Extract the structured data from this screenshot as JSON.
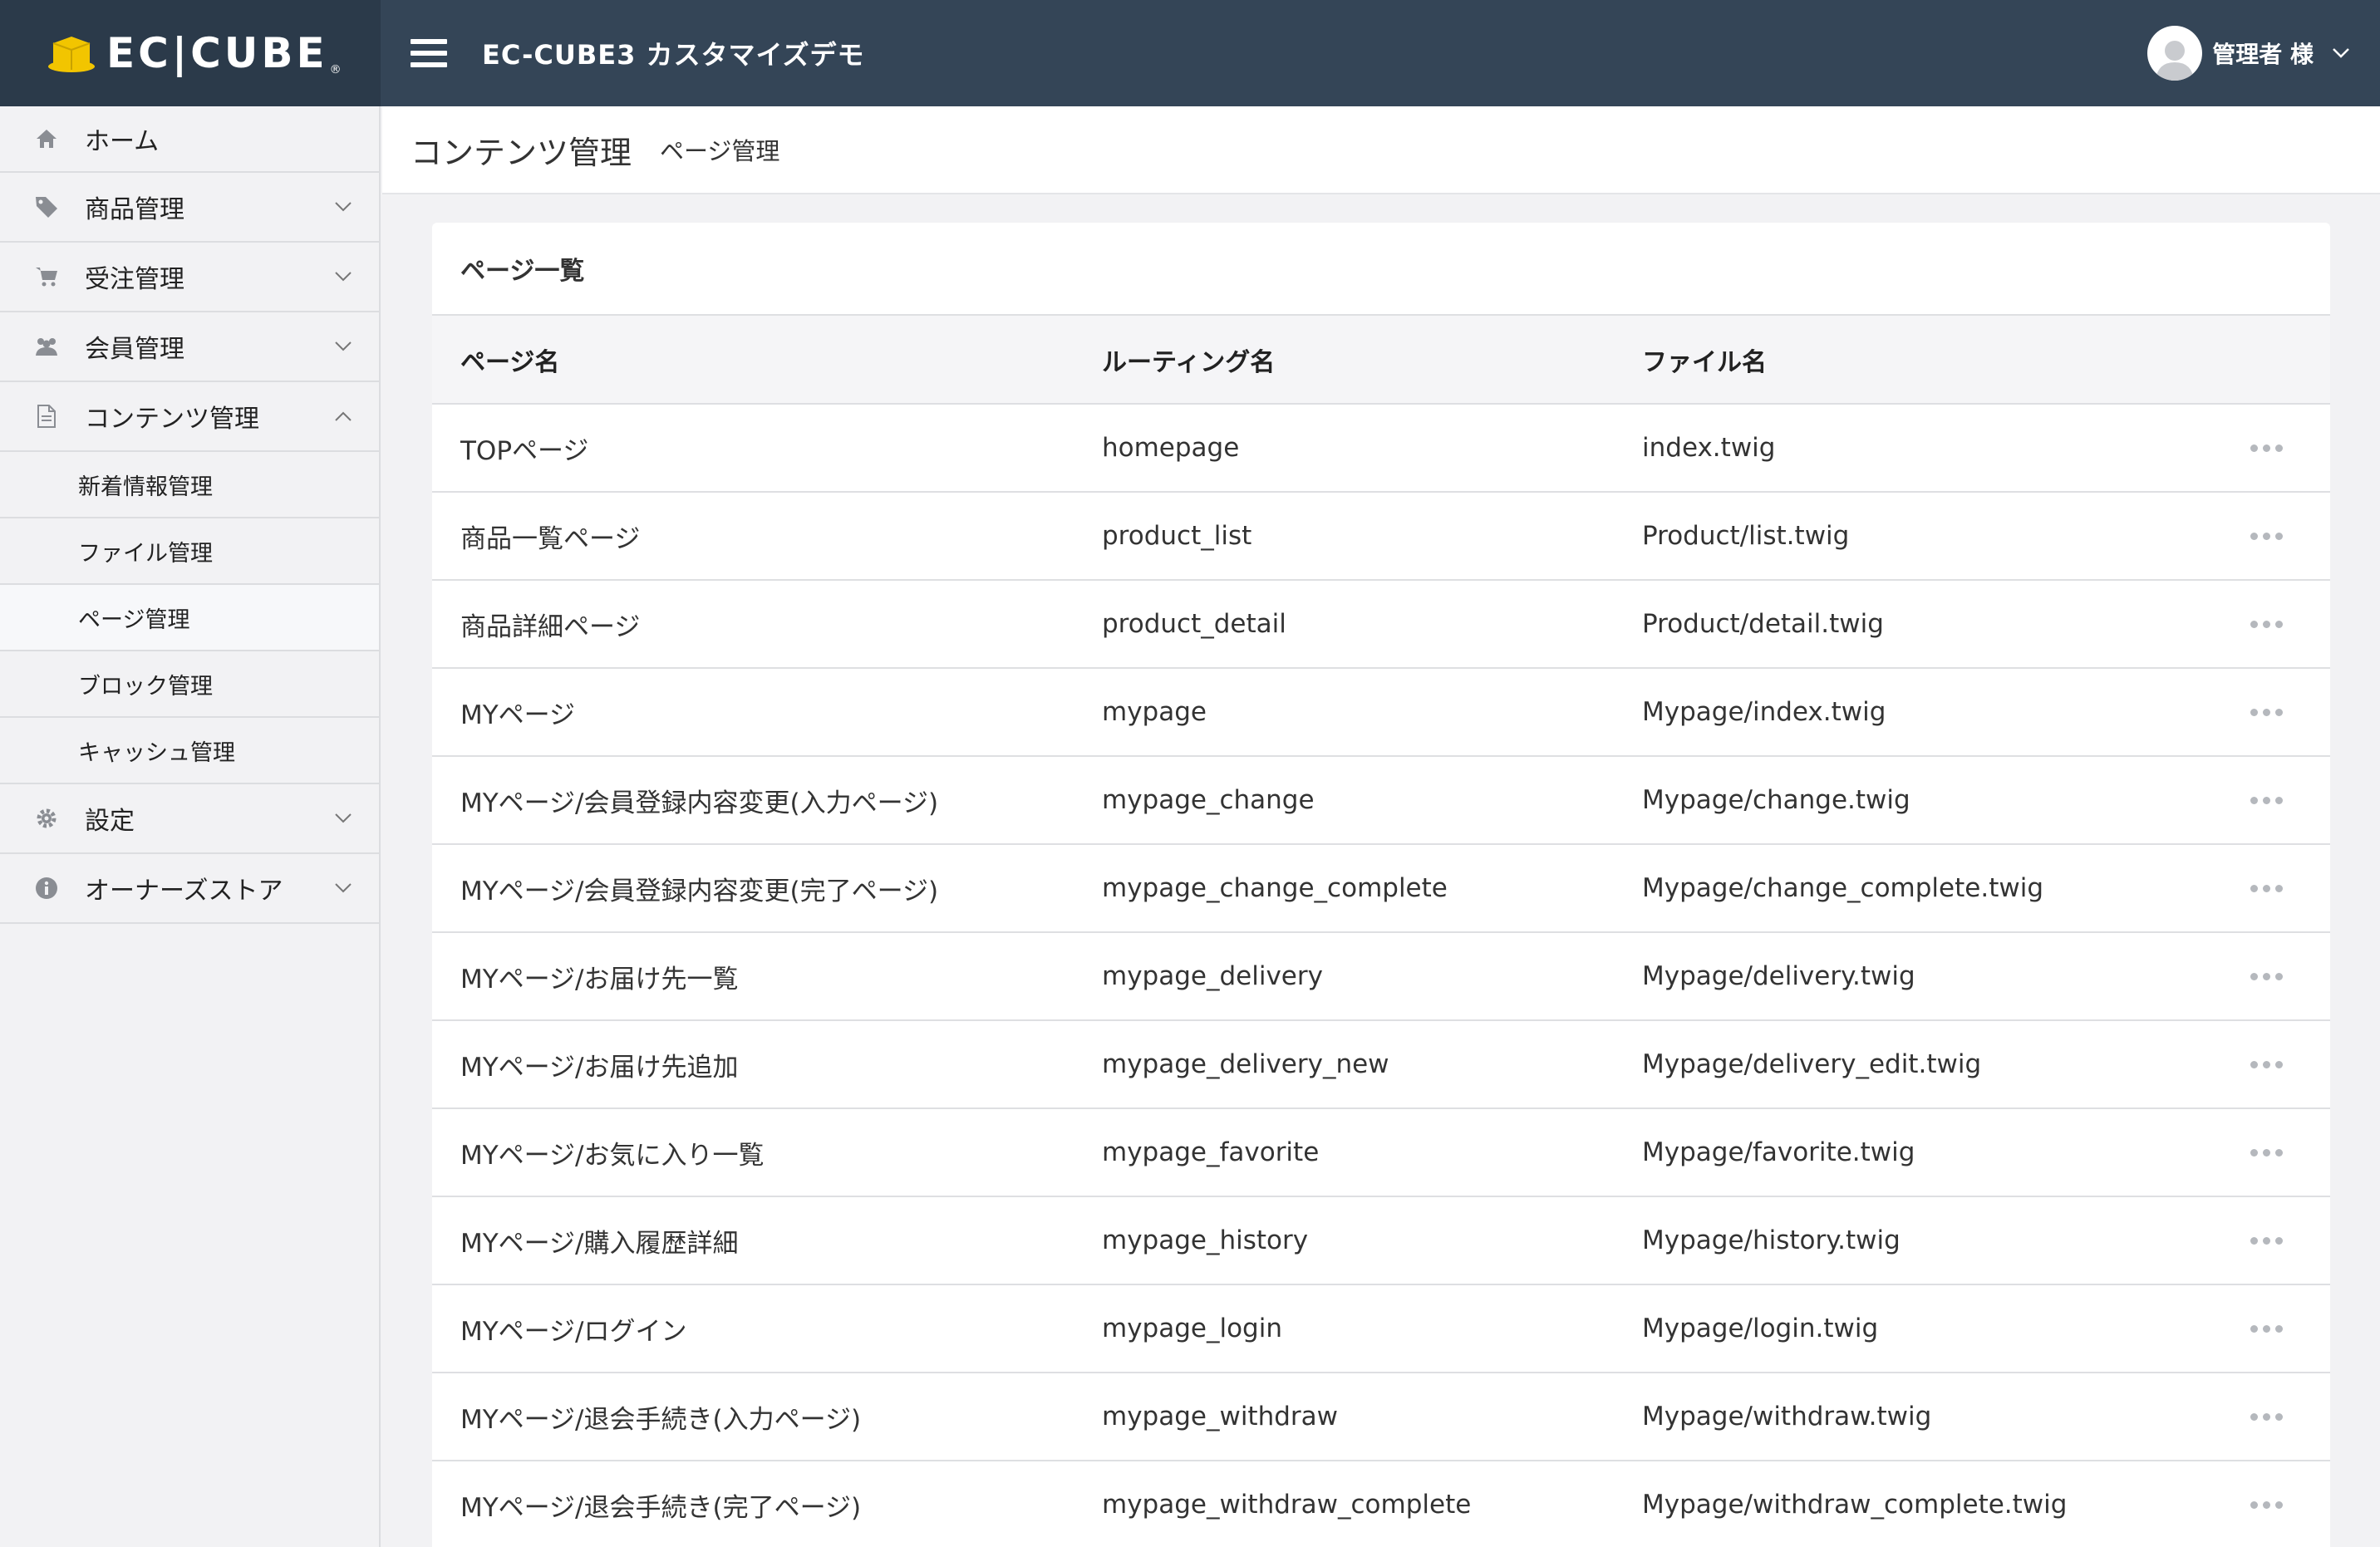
{
  "header": {
    "logo_text": "EC|CUBE",
    "site_title": "EC-CUBE3 カスタマイズデモ",
    "user_name": "管理者 様"
  },
  "sidebar": {
    "items": [
      {
        "label": "ホーム",
        "icon": "home-icon"
      },
      {
        "label": "商品管理",
        "icon": "tag-icon"
      },
      {
        "label": "受注管理",
        "icon": "cart-icon"
      },
      {
        "label": "会員管理",
        "icon": "users-icon"
      },
      {
        "label": "コンテンツ管理",
        "icon": "file-icon"
      }
    ],
    "sub_items": [
      "新着情報管理",
      "ファイル管理",
      "ページ管理",
      "ブロック管理",
      "キャッシュ管理"
    ],
    "items_after": [
      {
        "label": "設定",
        "icon": "gear-icon"
      },
      {
        "label": "オーナーズストア",
        "icon": "info-icon"
      }
    ]
  },
  "page": {
    "title": "コンテンツ管理",
    "subtitle": "ページ管理"
  },
  "card": {
    "title": "ページ一覧",
    "columns": [
      "ページ名",
      "ルーティング名",
      "ファイル名"
    ],
    "rows": [
      [
        "TOPページ",
        "homepage",
        "index.twig"
      ],
      [
        "商品一覧ページ",
        "product_list",
        "Product/list.twig"
      ],
      [
        "商品詳細ページ",
        "product_detail",
        "Product/detail.twig"
      ],
      [
        "MYページ",
        "mypage",
        "Mypage/index.twig"
      ],
      [
        "MYページ/会員登録内容変更(入力ページ)",
        "mypage_change",
        "Mypage/change.twig"
      ],
      [
        "MYページ/会員登録内容変更(完了ページ)",
        "mypage_change_complete",
        "Mypage/change_complete.twig"
      ],
      [
        "MYページ/お届け先一覧",
        "mypage_delivery",
        "Mypage/delivery.twig"
      ],
      [
        "MYページ/お届け先追加",
        "mypage_delivery_new",
        "Mypage/delivery_edit.twig"
      ],
      [
        "MYページ/お気に入り一覧",
        "mypage_favorite",
        "Mypage/favorite.twig"
      ],
      [
        "MYページ/購入履歴詳細",
        "mypage_history",
        "Mypage/history.twig"
      ],
      [
        "MYページ/ログイン",
        "mypage_login",
        "Mypage/login.twig"
      ],
      [
        "MYページ/退会手続き(入力ページ)",
        "mypage_withdraw",
        "Mypage/withdraw.twig"
      ],
      [
        "MYページ/退会手続き(完了ページ)",
        "mypage_withdraw_complete",
        "Mypage/withdraw_complete.twig"
      ]
    ]
  },
  "colors": {
    "header_bg": "#344557",
    "logo_bg": "#2b3a4a",
    "logo_accent": "#f2c500"
  }
}
